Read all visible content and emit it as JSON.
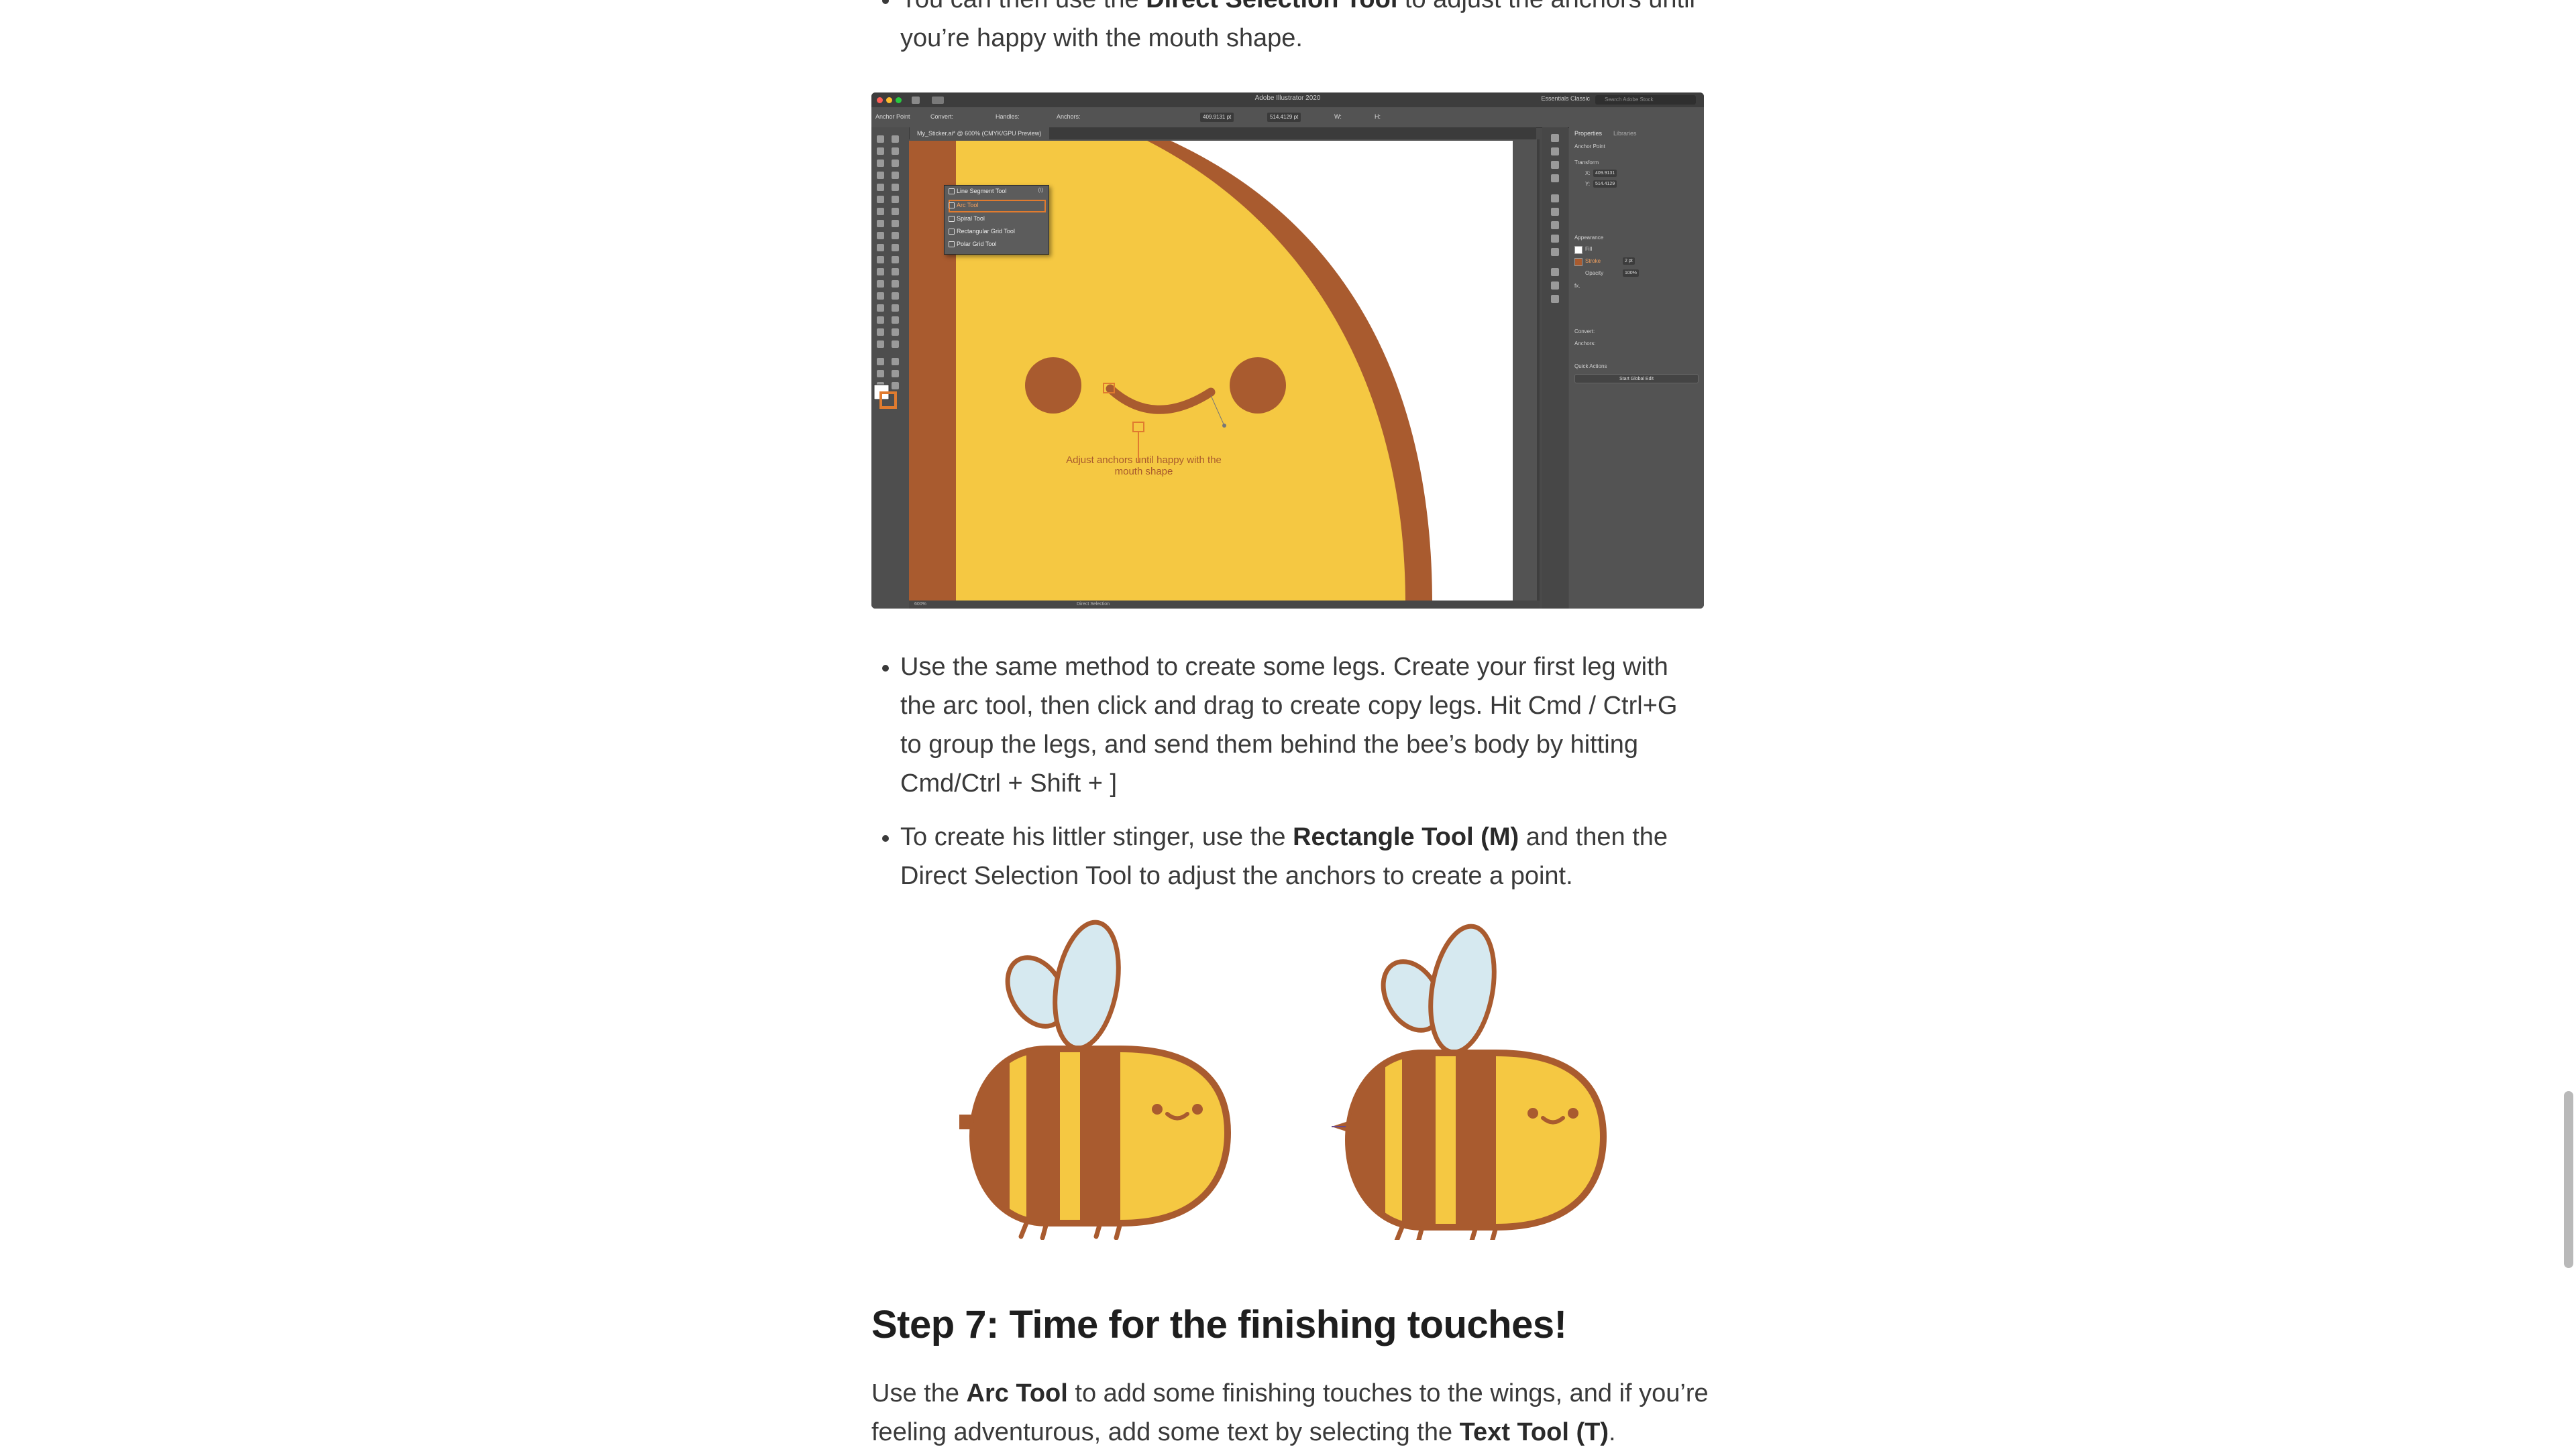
{
  "bullets_top": [
    {
      "pre": "You can then use the ",
      "bold": "Direct Selection Tool",
      "post": " to adjust the anchors until you’re happy with the mouth shape."
    }
  ],
  "screenshot": {
    "app_title": "Adobe Illustrator 2020",
    "workspace": "Essentials Classic",
    "search_placeholder": "Search Adobe Stock",
    "doc_tab": "My_Sticker.ai* @ 600% (CMYK/GPU Preview)",
    "control": {
      "anchor_point": "Anchor Point",
      "convert": "Convert:",
      "handles": "Handles:",
      "anchors": "Anchors:",
      "x_value": "409.9131 pt",
      "y_value": "514.4129 pt",
      "w": "W:",
      "h": "H:"
    },
    "flyout_items": [
      "Line Segment Tool",
      "Arc Tool",
      "Spiral Tool",
      "Rectangular Grid Tool",
      "Polar Grid Tool"
    ],
    "flyout_shortcut": "(\\)",
    "annotation": "Adjust anchors until happy with the mouth shape",
    "status_zoom": "600%",
    "status_tool": "Direct Selection",
    "panel": {
      "tab_properties": "Properties",
      "tab_libraries": "Libraries",
      "anchor_point": "Anchor Point",
      "transform": "Transform",
      "x_label": "X:",
      "y_label": "Y:",
      "x_value": "409.9131",
      "y_value": "514.4129",
      "appearance": "Appearance",
      "fill": "Fill",
      "stroke": "Stroke",
      "stroke_value": "2 pt",
      "opacity": "Opacity",
      "opacity_value": "100%",
      "fx": "fx.",
      "convert": "Convert:",
      "anchors": "Anchors:",
      "quick_actions": "Quick Actions",
      "start_global_edit": "Start Global Edit"
    }
  },
  "bullets_mid": [
    {
      "pre": "Use the same method to create some legs. Create your first leg with the arc tool, then click and drag to create copy legs. Hit Cmd / Ctrl+G to group the legs, and send them behind the bee’s body by hitting Cmd/Ctrl + Shift + ]",
      "bold": "",
      "post": ""
    },
    {
      "pre": "To create his littler stinger, use the ",
      "bold": "Rectangle Tool (M)",
      "post": " and then the Direct Selection Tool to adjust the anchors to create a point."
    }
  ],
  "step7": {
    "heading": "Step 7: Time for the finishing touches!",
    "p_pre": "Use the ",
    "p_bold1": "Arc Tool",
    "p_mid": " to add some finishing touches to the wings, and if you’re feeling adventurous, add some text by selecting the ",
    "p_bold2": "Text Tool (T)",
    "p_post": "."
  },
  "colors": {
    "bee_yellow": "#f5c842",
    "bee_brown": "#a95b2f",
    "wing_blue": "#d6e9f0",
    "accent_orange": "#e07b2f"
  }
}
